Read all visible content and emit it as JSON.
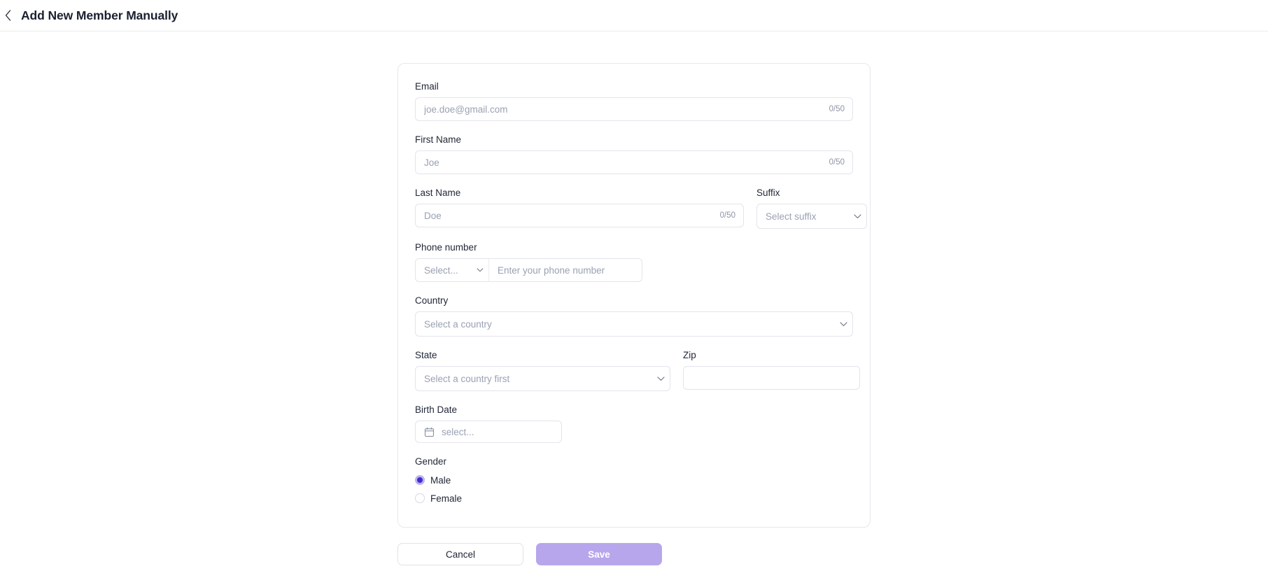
{
  "header": {
    "back_icon": "chevron-left-icon",
    "title": "Add New Member Manually"
  },
  "form": {
    "email": {
      "label": "Email",
      "placeholder": "joe.doe@gmail.com",
      "value": "",
      "counter": "0/50"
    },
    "first_name": {
      "label": "First Name",
      "placeholder": "Joe",
      "value": "",
      "counter": "0/50"
    },
    "last_name": {
      "label": "Last Name",
      "placeholder": "Doe",
      "value": "",
      "counter": "0/50"
    },
    "suffix": {
      "label": "Suffix",
      "selected": "Select suffix",
      "chevron_icon": "chevron-down-icon"
    },
    "phone": {
      "label": "Phone number",
      "code_selected": "Select...",
      "code_chevron_icon": "chevron-down-icon",
      "placeholder": "Enter your phone number",
      "value": ""
    },
    "country": {
      "label": "Country",
      "selected": "Select a country",
      "chevron_icon": "chevron-down-icon"
    },
    "state": {
      "label": "State",
      "selected": "Select a country first",
      "chevron_icon": "chevron-down-icon"
    },
    "zip": {
      "label": "Zip",
      "placeholder": "",
      "value": ""
    },
    "birth_date": {
      "label": "Birth Date",
      "calendar_icon": "calendar-icon",
      "value": "select..."
    },
    "gender": {
      "label": "Gender",
      "options": [
        {
          "label": "Male",
          "selected": true
        },
        {
          "label": "Female",
          "selected": false
        }
      ]
    }
  },
  "actions": {
    "cancel_label": "Cancel",
    "save_label": "Save"
  },
  "colors": {
    "accent": "#b8a6ec",
    "radio_fill": "#3b2ed0",
    "radio_ring": "#bfb0ef",
    "border": "#e4e4ec",
    "text": "#222838",
    "placeholder": "#9aa1b2"
  }
}
